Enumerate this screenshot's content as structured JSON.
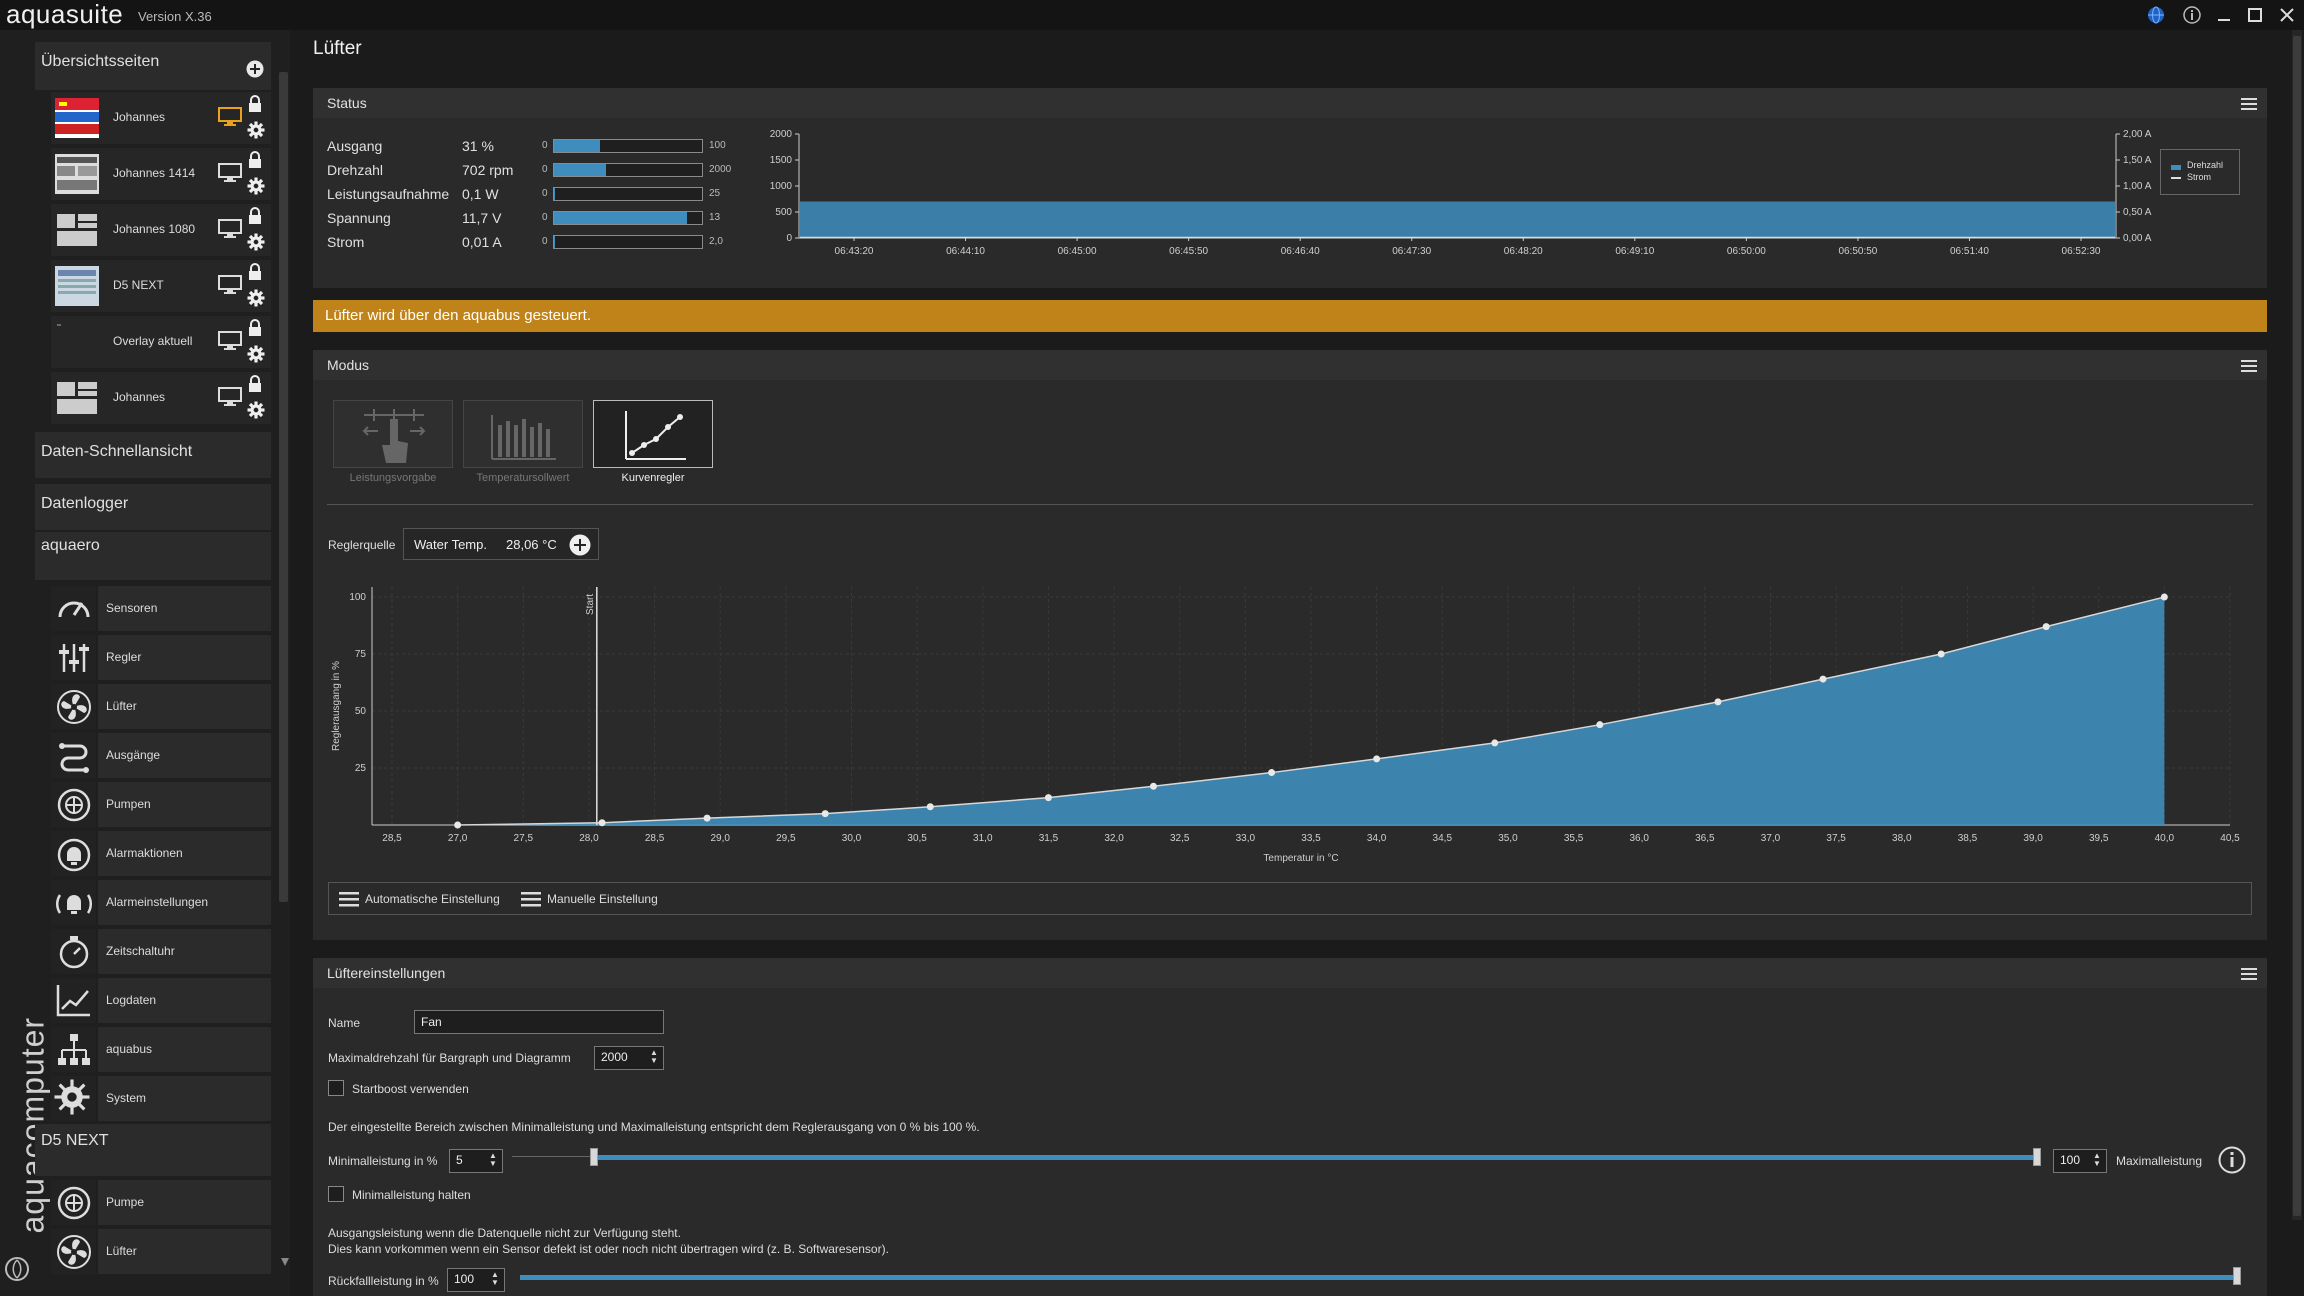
{
  "titlebar": {
    "app_name": "aquasuite",
    "version": "Version X.36"
  },
  "sidebar": {
    "overview_header": "Übersichtsseiten",
    "pages": [
      {
        "label": "Johannes"
      },
      {
        "label": "Johannes 1414"
      },
      {
        "label": "Johannes 1080"
      },
      {
        "label": "D5 NEXT"
      },
      {
        "label": "Overlay aktuell"
      },
      {
        "label": "Johannes"
      }
    ],
    "quick_view": "Daten-Schnellansicht",
    "datalogger": "Datenlogger",
    "device_aquaero": "aquaero",
    "aquaero_items": [
      {
        "label": "Sensoren",
        "icon": "gauge-icon"
      },
      {
        "label": "Regler",
        "icon": "sliders-icon"
      },
      {
        "label": "Lüfter",
        "icon": "fan-icon"
      },
      {
        "label": "Ausgänge",
        "icon": "outputs-icon"
      },
      {
        "label": "Pumpen",
        "icon": "pump-icon"
      },
      {
        "label": "Alarmaktionen",
        "icon": "alarm-icon"
      },
      {
        "label": "Alarmeinstellungen",
        "icon": "alarm-settings-icon"
      },
      {
        "label": "Zeitschaltuhr",
        "icon": "timer-icon"
      },
      {
        "label": "Logdaten",
        "icon": "chart-icon"
      },
      {
        "label": "aquabus",
        "icon": "network-icon"
      },
      {
        "label": "System",
        "icon": "gear-icon"
      }
    ],
    "device_d5": "D5 NEXT",
    "d5_items": [
      {
        "label": "Pumpe",
        "icon": "pump-icon"
      },
      {
        "label": "Lüfter",
        "icon": "fan-icon"
      }
    ],
    "brand": "aquacomputer"
  },
  "main": {
    "title": "Lüfter",
    "status": {
      "title": "Status",
      "rows": [
        {
          "label": "Ausgang",
          "value": "31 %",
          "min": "0",
          "max": "100",
          "fill": 0.31
        },
        {
          "label": "Drehzahl",
          "value": "702 rpm",
          "min": "0",
          "max": "2000",
          "fill": 0.351
        },
        {
          "label": "Leistungsaufnahme",
          "value": "0,1 W",
          "min": "0",
          "max": "25",
          "fill": 0.004
        },
        {
          "label": "Spannung",
          "value": "11,7 V",
          "min": "0",
          "max": "13",
          "fill": 0.9
        },
        {
          "label": "Strom",
          "value": "0,01 A",
          "min": "0",
          "max": "2,0",
          "fill": 0.005
        }
      ]
    },
    "banner": "Lüfter wird über den aquabus gesteuert.",
    "mode": {
      "title": "Modus",
      "buttons": [
        {
          "label": "Leistungsvorgabe"
        },
        {
          "label": "Temperatursollwert"
        },
        {
          "label": "Kurvenregler"
        }
      ],
      "source_label": "Reglerquelle",
      "source_name": "Water Temp.",
      "source_value": "28,06 °C",
      "auto_label": "Automatische Einstellung",
      "manual_label": "Manuelle Einstellung"
    },
    "settings": {
      "title": "Lüftereinstellungen",
      "name_label": "Name",
      "name_value": "Fan",
      "maxrpm_label": "Maximaldrehzahl für Bargraph und Diagramm",
      "maxrpm_value": "2000",
      "startboost_label": "Startboost verwenden",
      "range_info": "Der eingestellte Bereich zwischen Minimalleistung und Maximalleistung entspricht dem Reglerausgang von 0 % bis 100 %.",
      "min_label": "Minimalleistung in %",
      "min_value": "5",
      "max_value": "100",
      "max_label": "Maximalleistung",
      "hold_min_label": "Minimalleistung halten",
      "fallback_info_1": "Ausgangsleistung wenn die Datenquelle nicht zur Verfügung steht.",
      "fallback_info_2": "Dies kann vorkommen wenn ein Sensor defekt ist oder noch nicht übertragen wird (z. B. Softwaresensor).",
      "fallback_label": "Rückfallleistung in %",
      "fallback_value": "100"
    }
  },
  "colors": {
    "accent": "#3e8dbd",
    "banner": "#c0831a",
    "panel": "#2a2a2a",
    "background": "#1b1b1b"
  },
  "chart_data": [
    {
      "type": "area",
      "title": "Status",
      "x": [
        "06:43:20",
        "06:44:10",
        "06:45:00",
        "06:45:50",
        "06:46:40",
        "06:47:30",
        "06:48:20",
        "06:49:10",
        "06:50:00",
        "06:50:50",
        "06:51:40",
        "06:52:30"
      ],
      "yticks_left": [
        "0",
        "500",
        "1000",
        "1500",
        "2000"
      ],
      "yticks_right": [
        "0,00 A",
        "0,50 A",
        "1,00 A",
        "1,50 A",
        "2,00 A"
      ],
      "ylim": [
        0,
        2000
      ],
      "series": [
        {
          "name": "Drehzahl",
          "value": 702
        },
        {
          "name": "Strom",
          "value": 0.01
        }
      ],
      "legend": "top-right",
      "grid": false
    },
    {
      "type": "line",
      "xlabel": "Temperatur in °C",
      "ylabel": "Reglerausgang in %",
      "xlim": [
        28.25,
        40.5
      ],
      "ylim": [
        0,
        100
      ],
      "xticks": [
        "28,5",
        "27,0",
        "27,5",
        "28,0",
        "28,5",
        "29,0",
        "29,5",
        "30,0",
        "30,5",
        "31,0",
        "31,5",
        "32,0",
        "32,5",
        "33,0",
        "33,5",
        "34,0",
        "34,5",
        "35,0",
        "35,5",
        "36,0",
        "36,5",
        "37,0",
        "37,5",
        "38,0",
        "38,5",
        "39,0",
        "39,5",
        "40,0",
        "40,5"
      ],
      "yticks": [
        "25",
        "50",
        "75",
        "100"
      ],
      "start_label": "Start",
      "start_x": 28.06,
      "points": [
        {
          "x": 27.0,
          "y": 0
        },
        {
          "x": 28.1,
          "y": 1
        },
        {
          "x": 28.9,
          "y": 3
        },
        {
          "x": 29.8,
          "y": 5
        },
        {
          "x": 30.6,
          "y": 8
        },
        {
          "x": 31.5,
          "y": 12
        },
        {
          "x": 32.3,
          "y": 17
        },
        {
          "x": 33.2,
          "y": 23
        },
        {
          "x": 34.0,
          "y": 29
        },
        {
          "x": 34.9,
          "y": 36
        },
        {
          "x": 35.7,
          "y": 44
        },
        {
          "x": 36.6,
          "y": 54
        },
        {
          "x": 37.4,
          "y": 64
        },
        {
          "x": 38.3,
          "y": 75
        },
        {
          "x": 39.1,
          "y": 87
        },
        {
          "x": 40.0,
          "y": 100
        }
      ],
      "grid": true
    }
  ]
}
